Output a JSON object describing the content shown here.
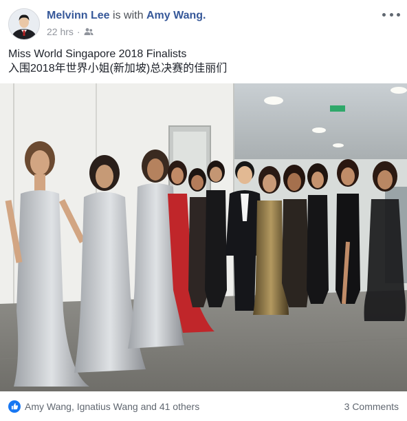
{
  "post": {
    "author": "Melvinn Lee",
    "connector": "is with",
    "tagged": "Amy Wang.",
    "time": "22 hrs",
    "separator": "·",
    "audience_icon": "friends-icon",
    "caption_line1": "Miss World Singapore 2018 Finalists",
    "caption_line2": "入围2018年世界小姐(新加坡)总决赛的佳丽们"
  },
  "footer": {
    "reactions_text": "Amy Wang, Ignatius Wang and 41 others",
    "reaction_icon": "like-icon",
    "comments_text": "3 Comments"
  },
  "colors": {
    "link": "#365899",
    "meta": "#90949c",
    "like": "#1877f2"
  }
}
